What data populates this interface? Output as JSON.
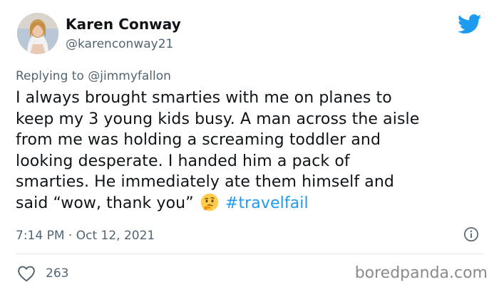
{
  "author": {
    "name": "Karen Conway",
    "handle": "@karenconway21"
  },
  "reply": {
    "prefix": "Replying to",
    "mention": "@jimmyfallon"
  },
  "tweet": {
    "text_lines": [
      "I always brought smarties with me on planes to",
      "keep my 3 young kids busy. A man across the aisle",
      "from me was holding a screaming toddler and",
      "looking desperate. I handed him a pack of",
      "smarties. He immediately ate them himself and",
      "said “wow, thank you”"
    ],
    "emoji": "thinking-face",
    "hashtag": "#travelfail"
  },
  "meta": {
    "time": "7:14 PM",
    "separator": "·",
    "date": "Oct 12, 2021"
  },
  "engagement": {
    "likes": "263"
  },
  "watermark": "boredpanda.com",
  "colors": {
    "link": "#1d9bf0",
    "secondary_text": "#536471",
    "primary_text": "#0f1419"
  },
  "icons": {
    "brand": "twitter-bird-icon",
    "info": "info-icon",
    "like": "heart-icon"
  }
}
